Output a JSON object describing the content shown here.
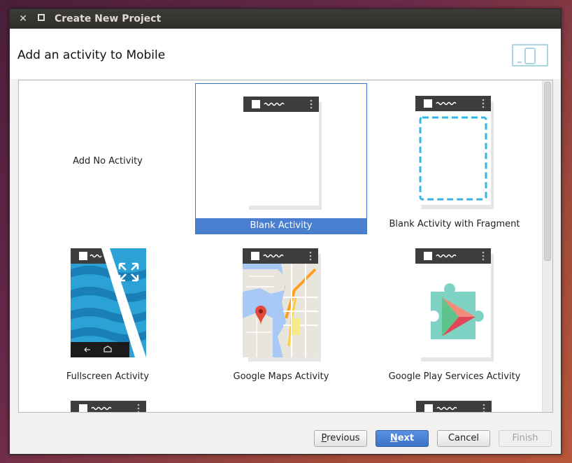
{
  "window": {
    "title": "Create New Project"
  },
  "header": {
    "title": "Add an activity to Mobile"
  },
  "gallery": {
    "items": [
      {
        "label": "Add No Activity",
        "thumbnail": "none"
      },
      {
        "label": "Blank Activity",
        "thumbnail": "blank-phone",
        "selected": true
      },
      {
        "label": "Blank Activity with Fragment",
        "thumbnail": "fragment-phone"
      },
      {
        "label": "Fullscreen Activity",
        "thumbnail": "fullscreen-phone"
      },
      {
        "label": "Google Maps Activity",
        "thumbnail": "maps-phone"
      },
      {
        "label": "Google Play Services Activity",
        "thumbnail": "play-services-phone"
      }
    ]
  },
  "buttons": {
    "previous": {
      "first": "P",
      "rest": "revious"
    },
    "next": {
      "first": "N",
      "rest": "ext"
    },
    "cancel": "Cancel",
    "finish": "Finish"
  },
  "colors": {
    "accent": "#4a7fd0",
    "titlebar": "#3c3b37",
    "phone_frame": "#3d3d3d",
    "fragment_dash": "#33b5e5"
  }
}
